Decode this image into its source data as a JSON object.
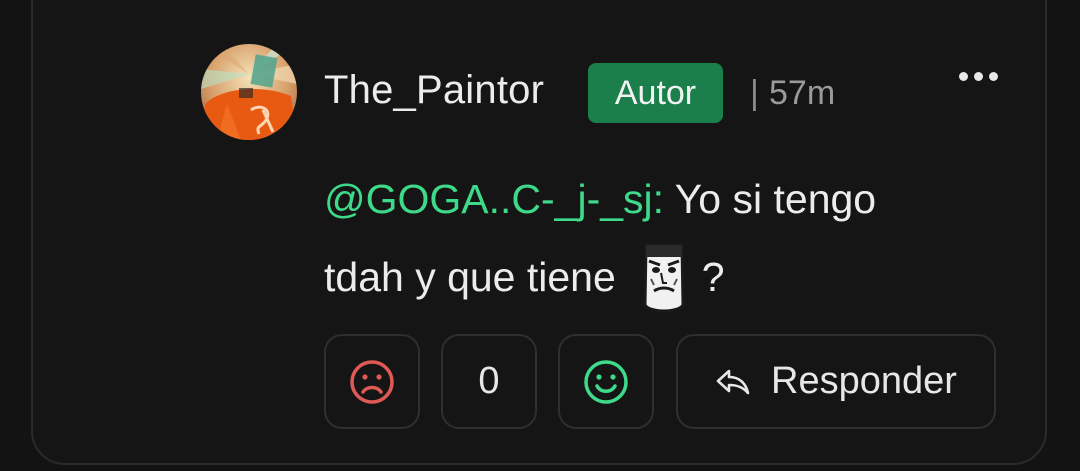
{
  "comment": {
    "author": "The_Paintor",
    "badge": "Autor",
    "separator": "|",
    "time": "57m",
    "mention": "@GOGA..C-_j-_sj:",
    "text_part1": "Yo si tengo tdah y que tiene",
    "text_part2": "?",
    "sticker_icon": "grumpy-face-sticker",
    "menu_icon": "more-horizontal-icon"
  },
  "actions": {
    "dislike_icon": "sad-face-icon",
    "vote_count": "0",
    "like_icon": "happy-face-icon",
    "reply_icon": "reply-arrow-icon",
    "reply_label": "Responder"
  },
  "colors": {
    "background": "#131313",
    "badge": "#1a7f4b",
    "mention": "#3fd98a",
    "dislike": "#e05a55",
    "like": "#3fd98a"
  }
}
